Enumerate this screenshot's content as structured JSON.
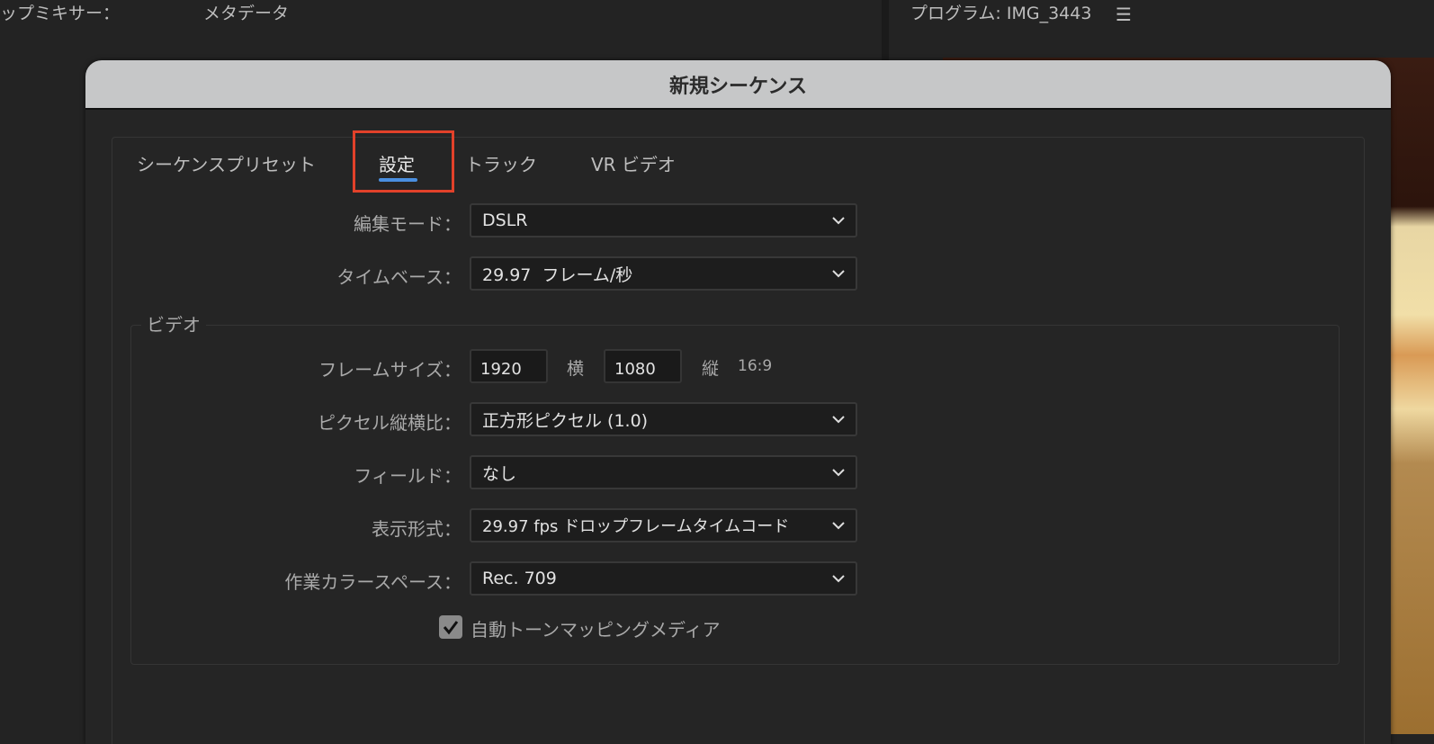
{
  "background": {
    "left_panel_tabs": [
      "ップミキサー：",
      "メタデータ"
    ],
    "program_title": "プログラム: IMG_3443",
    "menu_icon": "hamburger-icon"
  },
  "dialog": {
    "title": "新規シーケンス",
    "tabs": [
      {
        "label": "シーケンスプリセット"
      },
      {
        "label": "設定",
        "active": true
      },
      {
        "label": "トラック"
      },
      {
        "label": "VR ビデオ"
      }
    ],
    "highlight_color": "#e2412a",
    "accent_color": "#4a8fe0",
    "edit_mode": {
      "label": "編集モード：",
      "value": "DSLR"
    },
    "timebase": {
      "label": "タイムベース：",
      "value": "29.97  フレーム/秒"
    },
    "video": {
      "legend": "ビデオ",
      "frame_size": {
        "label": "フレームサイズ：",
        "width": "1920",
        "width_unit": "横",
        "height": "1080",
        "height_unit": "縦",
        "aspect": "16:9"
      },
      "pixel_aspect": {
        "label": "ピクセル縦横比：",
        "value": "正方形ピクセル (1.0)"
      },
      "fields": {
        "label": "フィールド：",
        "value": "なし"
      },
      "display_format": {
        "label": "表示形式：",
        "value": "29.97 fps ドロップフレームタイムコード"
      },
      "color_space": {
        "label": "作業カラースペース：",
        "value": "Rec. 709"
      },
      "auto_tone_mapping": {
        "label": "自動トーンマッピングメディア",
        "checked": true
      }
    }
  }
}
